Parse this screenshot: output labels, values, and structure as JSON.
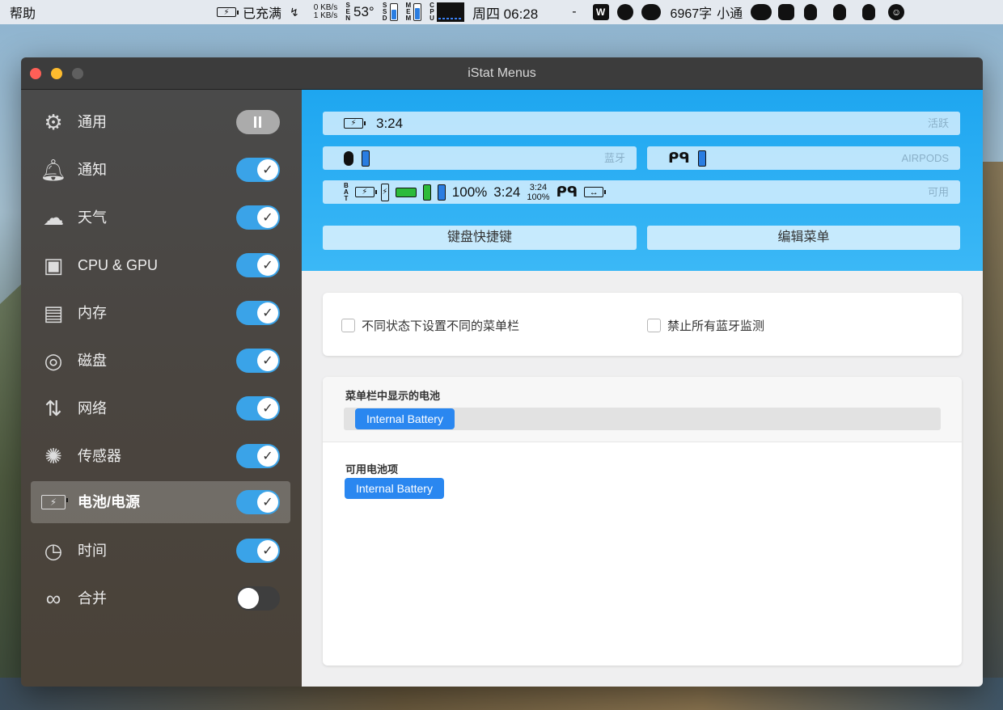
{
  "menubar": {
    "app_menu": "帮助",
    "battery_status": "已充满",
    "net_up": "0 KB/s",
    "net_down": "1 KB/s",
    "sensor_label": [
      "S",
      "E",
      "N"
    ],
    "temperature": "53°",
    "ssd_label": [
      "S",
      "S",
      "D"
    ],
    "mem_label": [
      "M",
      "E",
      "M"
    ],
    "cpu_label": [
      "C",
      "P",
      "U"
    ],
    "clock": "周四 06:28",
    "separator": "-",
    "word_count": "6967字",
    "input_method": "小通",
    "icons": [
      "wps-icon",
      "moon-icon",
      "creative-cloud-icon",
      "wechat-icon",
      "evernote-icon",
      "qq-icon",
      "qq-icon",
      "qq-icon",
      "smiley-icon"
    ]
  },
  "window": {
    "title": "iStat Menus"
  },
  "sidebar": {
    "items": [
      {
        "label": "通用",
        "icon": "gear-icon",
        "toggle": "pause"
      },
      {
        "label": "通知",
        "icon": "bell-icon",
        "toggle": "on"
      },
      {
        "label": "天气",
        "icon": "weather-icon",
        "toggle": "on"
      },
      {
        "label": "CPU & GPU",
        "icon": "chip-icon",
        "toggle": "on"
      },
      {
        "label": "内存",
        "icon": "memory-icon",
        "toggle": "on"
      },
      {
        "label": "磁盘",
        "icon": "disk-icon",
        "toggle": "on"
      },
      {
        "label": "网络",
        "icon": "network-icon",
        "toggle": "on"
      },
      {
        "label": "传感器",
        "icon": "fan-icon",
        "toggle": "on"
      },
      {
        "label": "电池/电源",
        "icon": "battery-power-icon",
        "toggle": "on",
        "active": true
      },
      {
        "label": "时间",
        "icon": "clock-icon",
        "toggle": "on"
      },
      {
        "label": "合并",
        "icon": "combine-icon",
        "toggle": "off"
      }
    ]
  },
  "header": {
    "active_pill": {
      "time": "3:24",
      "tag": "活跃"
    },
    "bluetooth_pill": {
      "tag": "蓝牙"
    },
    "airpods_pill": {
      "tag": "AIRPODS"
    },
    "available_pill": {
      "bat_label": [
        "B",
        "A",
        "T"
      ],
      "percent": "100%",
      "time": "3:24",
      "stack_time": "3:24",
      "stack_percent": "100%",
      "tag": "可用"
    },
    "buttons": {
      "shortcuts": "键盘快捷键",
      "edit_menu": "编辑菜单"
    }
  },
  "options": {
    "different_menubar": "不同状态下设置不同的菜单栏",
    "disable_bluetooth": "禁止所有蓝牙监测"
  },
  "batteries": {
    "menubar_section": "菜单栏中显示的电池",
    "menubar_items": [
      "Internal Battery"
    ],
    "available_section": "可用电池项",
    "available_items": [
      "Internal Battery"
    ]
  }
}
